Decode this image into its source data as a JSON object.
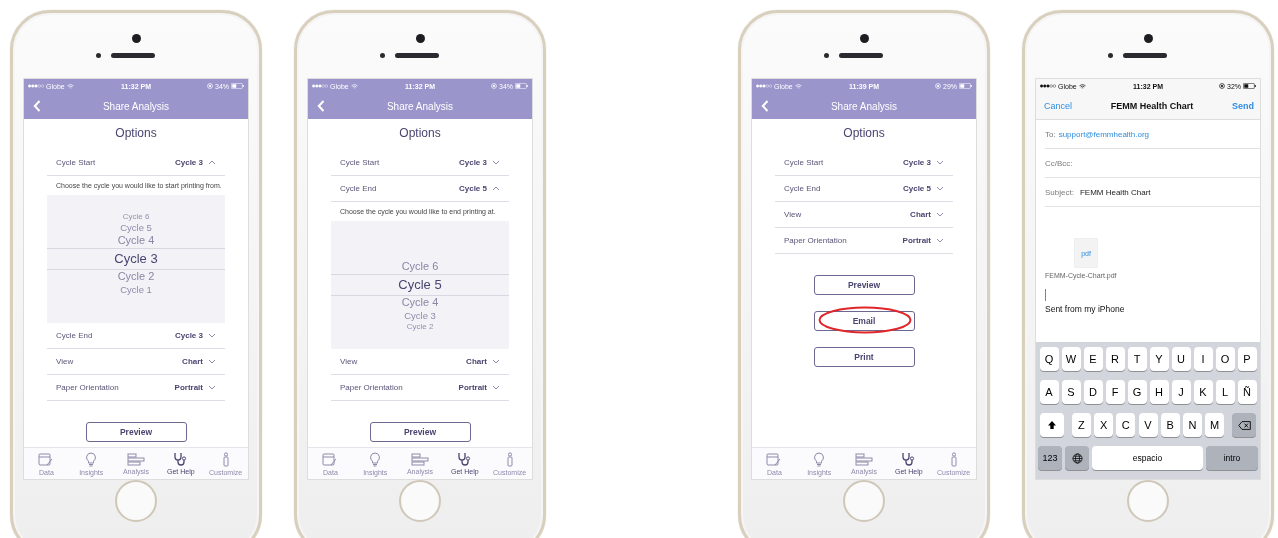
{
  "phones": [
    {
      "kind": "options",
      "status_bar": {
        "carrier": "Globe",
        "time": "11:32 PM",
        "battery": "34%"
      },
      "nav_title": "Share Analysis",
      "heading": "Options",
      "options": [
        {
          "label": "Cycle Start",
          "value": "Cycle 3",
          "expanded": true,
          "hint": "Choose the cycle you would like to start printing from.",
          "picker": [
            {
              "label": "Cycle 6",
              "selected": false
            },
            {
              "label": "Cycle 5",
              "selected": false
            },
            {
              "label": "Cycle 4",
              "selected": false
            },
            {
              "label": "Cycle 3",
              "selected": true
            },
            {
              "label": "Cycle 2",
              "selected": false
            },
            {
              "label": "Cycle 1",
              "selected": false
            }
          ]
        },
        {
          "label": "Cycle End",
          "value": "Cycle 3",
          "expanded": false
        },
        {
          "label": "View",
          "value": "Chart",
          "expanded": false
        },
        {
          "label": "Paper Orientation",
          "value": "Portrait",
          "expanded": false
        }
      ],
      "buttons": [
        {
          "label": "Preview",
          "circled": false
        }
      ],
      "tab_bar": [
        {
          "label": "Data",
          "selected": false
        },
        {
          "label": "Insights",
          "selected": false
        },
        {
          "label": "Analysis",
          "selected": false
        },
        {
          "label": "Get Help",
          "selected": true
        },
        {
          "label": "Customize",
          "selected": false
        }
      ]
    },
    {
      "kind": "options",
      "status_bar": {
        "carrier": "Globe",
        "time": "11:32 PM",
        "battery": "34%"
      },
      "nav_title": "Share Analysis",
      "heading": "Options",
      "options": [
        {
          "label": "Cycle Start",
          "value": "Cycle 3",
          "expanded": false
        },
        {
          "label": "Cycle End",
          "value": "Cycle 5",
          "expanded": true,
          "hint": "Choose the cycle you would like to end printing at.",
          "picker": [
            {
              "label": "Cycle 6",
              "selected": false
            },
            {
              "label": "Cycle 5",
              "selected": true
            },
            {
              "label": "Cycle 4",
              "selected": false
            },
            {
              "label": "Cycle 3",
              "selected": false
            },
            {
              "label": "Cycle 2",
              "selected": false
            }
          ]
        },
        {
          "label": "View",
          "value": "Chart",
          "expanded": false
        },
        {
          "label": "Paper Orientation",
          "value": "Portrait",
          "expanded": false
        }
      ],
      "buttons": [
        {
          "label": "Preview",
          "circled": false
        }
      ],
      "tab_bar": [
        {
          "label": "Data",
          "selected": false
        },
        {
          "label": "Insights",
          "selected": false
        },
        {
          "label": "Analysis",
          "selected": false
        },
        {
          "label": "Get Help",
          "selected": true
        },
        {
          "label": "Customize",
          "selected": false
        }
      ]
    },
    {
      "kind": "options",
      "status_bar": {
        "carrier": "Globe",
        "time": "11:39 PM",
        "battery": "29%"
      },
      "nav_title": "Share Analysis",
      "heading": "Options",
      "options": [
        {
          "label": "Cycle Start",
          "value": "Cycle 3",
          "expanded": false
        },
        {
          "label": "Cycle End",
          "value": "Cycle 5",
          "expanded": false
        },
        {
          "label": "View",
          "value": "Chart",
          "expanded": false
        },
        {
          "label": "Paper Orientation",
          "value": "Portrait",
          "expanded": false
        }
      ],
      "buttons": [
        {
          "label": "Preview",
          "circled": false
        },
        {
          "label": "Email",
          "circled": true
        },
        {
          "label": "Print",
          "circled": false
        }
      ],
      "tab_bar": [
        {
          "label": "Data",
          "selected": false
        },
        {
          "label": "Insights",
          "selected": false
        },
        {
          "label": "Analysis",
          "selected": false
        },
        {
          "label": "Get Help",
          "selected": true
        },
        {
          "label": "Customize",
          "selected": false
        }
      ]
    },
    {
      "kind": "mail",
      "status_bar": {
        "carrier": "Globe",
        "time": "11:32 PM",
        "battery": "32%"
      },
      "cancel": "Cancel",
      "title": "FEMM Health Chart",
      "send": "Send",
      "fields": [
        {
          "label": "To:",
          "value": "support@femmhealth.org",
          "kind": "recipient"
        },
        {
          "label": "Cc/Bcc:"
        },
        {
          "label": "Subject:",
          "value": "FEMM Health Chart",
          "kind": "text"
        }
      ],
      "attachment": {
        "type": "pdf",
        "filename": "FEMM-Cycle-Chart.pdf"
      },
      "body": "Sent from my iPhone",
      "keyboard": [
        [
          {
            "kind": "letter",
            "label": "Q"
          },
          {
            "kind": "letter",
            "label": "W"
          },
          {
            "kind": "letter",
            "label": "E"
          },
          {
            "kind": "letter",
            "label": "R"
          },
          {
            "kind": "letter",
            "label": "T"
          },
          {
            "kind": "letter",
            "label": "Y"
          },
          {
            "kind": "letter",
            "label": "U"
          },
          {
            "kind": "letter",
            "label": "I"
          },
          {
            "kind": "letter",
            "label": "O"
          },
          {
            "kind": "letter",
            "label": "P"
          }
        ],
        [
          {
            "kind": "letter",
            "label": "A"
          },
          {
            "kind": "letter",
            "label": "S"
          },
          {
            "kind": "letter",
            "label": "D"
          },
          {
            "kind": "letter",
            "label": "F"
          },
          {
            "kind": "letter",
            "label": "G"
          },
          {
            "kind": "letter",
            "label": "H"
          },
          {
            "kind": "letter",
            "label": "J"
          },
          {
            "kind": "letter",
            "label": "K"
          },
          {
            "kind": "letter",
            "label": "L"
          },
          {
            "kind": "letter",
            "label": "Ñ"
          }
        ],
        [
          {
            "kind": "shift"
          },
          {
            "kind": "letter",
            "label": "Z"
          },
          {
            "kind": "letter",
            "label": "X"
          },
          {
            "kind": "letter",
            "label": "C"
          },
          {
            "kind": "letter",
            "label": "V"
          },
          {
            "kind": "letter",
            "label": "B"
          },
          {
            "kind": "letter",
            "label": "N"
          },
          {
            "kind": "letter",
            "label": "M"
          },
          {
            "kind": "delete"
          }
        ],
        [
          {
            "kind": "mode",
            "label": "123"
          },
          {
            "kind": "globe"
          },
          {
            "kind": "space",
            "label": "espacio"
          },
          {
            "kind": "return",
            "label": "intro"
          }
        ]
      ]
    }
  ]
}
